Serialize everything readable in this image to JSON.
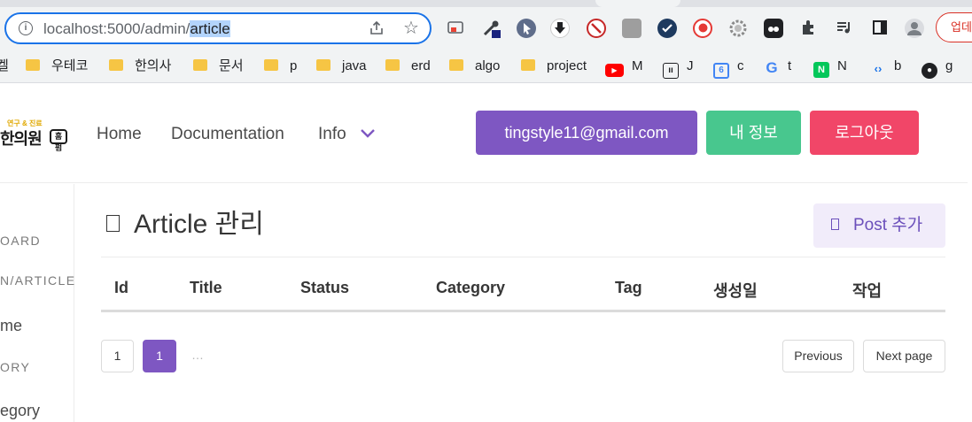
{
  "browser": {
    "url_host": "localhost:5000/admin/",
    "url_selected": "article",
    "update_label": "업데",
    "colors": {
      "omnibox_border": "#1a73e8",
      "update_border": "#d93025"
    },
    "extensions": [
      {
        "icon": "cast-icon"
      },
      {
        "icon": "eyedropper-icon"
      },
      {
        "icon": "cursor-icon"
      },
      {
        "icon": "download-icon"
      },
      {
        "icon": "block-icon"
      },
      {
        "icon": "avatar-ext-icon"
      },
      {
        "icon": "check-circle-icon"
      },
      {
        "icon": "record-icon"
      },
      {
        "icon": "gear-icon"
      },
      {
        "icon": "ghost-icon"
      },
      {
        "icon": "puzzle-icon"
      },
      {
        "icon": "media-queue-icon"
      },
      {
        "icon": "side-panel-icon"
      },
      {
        "icon": "profile-icon"
      }
    ]
  },
  "bookmarks": [
    {
      "label": "우테코",
      "icon": "folder"
    },
    {
      "label": "한의사",
      "icon": "folder"
    },
    {
      "label": "문서",
      "icon": "folder"
    },
    {
      "label": "p",
      "icon": "folder"
    },
    {
      "label": "java",
      "icon": "folder"
    },
    {
      "label": "erd",
      "icon": "folder"
    },
    {
      "label": "algo",
      "icon": "folder"
    },
    {
      "label": "project",
      "icon": "folder"
    },
    {
      "label": "M",
      "icon": "youtube"
    },
    {
      "label": "J",
      "icon": "jira"
    },
    {
      "label": "c",
      "icon": "calendar"
    },
    {
      "label": "t",
      "icon": "google"
    },
    {
      "label": "N",
      "icon": "naver"
    },
    {
      "label": "b",
      "icon": "code"
    },
    {
      "label": "g",
      "icon": "github"
    }
  ],
  "header": {
    "logo_small": "연구 & 진료",
    "logo_big": "한의원",
    "logo_badge": "홈펌",
    "nav": [
      "Home",
      "Documentation",
      "Info"
    ],
    "email_button": "tingstyle11@gmail.com",
    "myinfo_button": "내 정보",
    "logout_button": "로그아웃",
    "colors": {
      "email": "#7e57c2",
      "myinfo": "#48c78e",
      "logout": "#f14668"
    }
  },
  "sidebar": {
    "label1": "OARD",
    "label2": "N/ARTICLE",
    "item1": "me",
    "label3": "ORY",
    "item2": "egory"
  },
  "main": {
    "title": "Article 관리",
    "post_button": "Post 추가",
    "columns": [
      "Id",
      "Title",
      "Status",
      "Category",
      "Tag",
      "생성일",
      "작업"
    ],
    "pagination": {
      "first": "1",
      "current": "1",
      "ellipsis": "…",
      "previous": "Previous",
      "next": "Next page"
    }
  }
}
